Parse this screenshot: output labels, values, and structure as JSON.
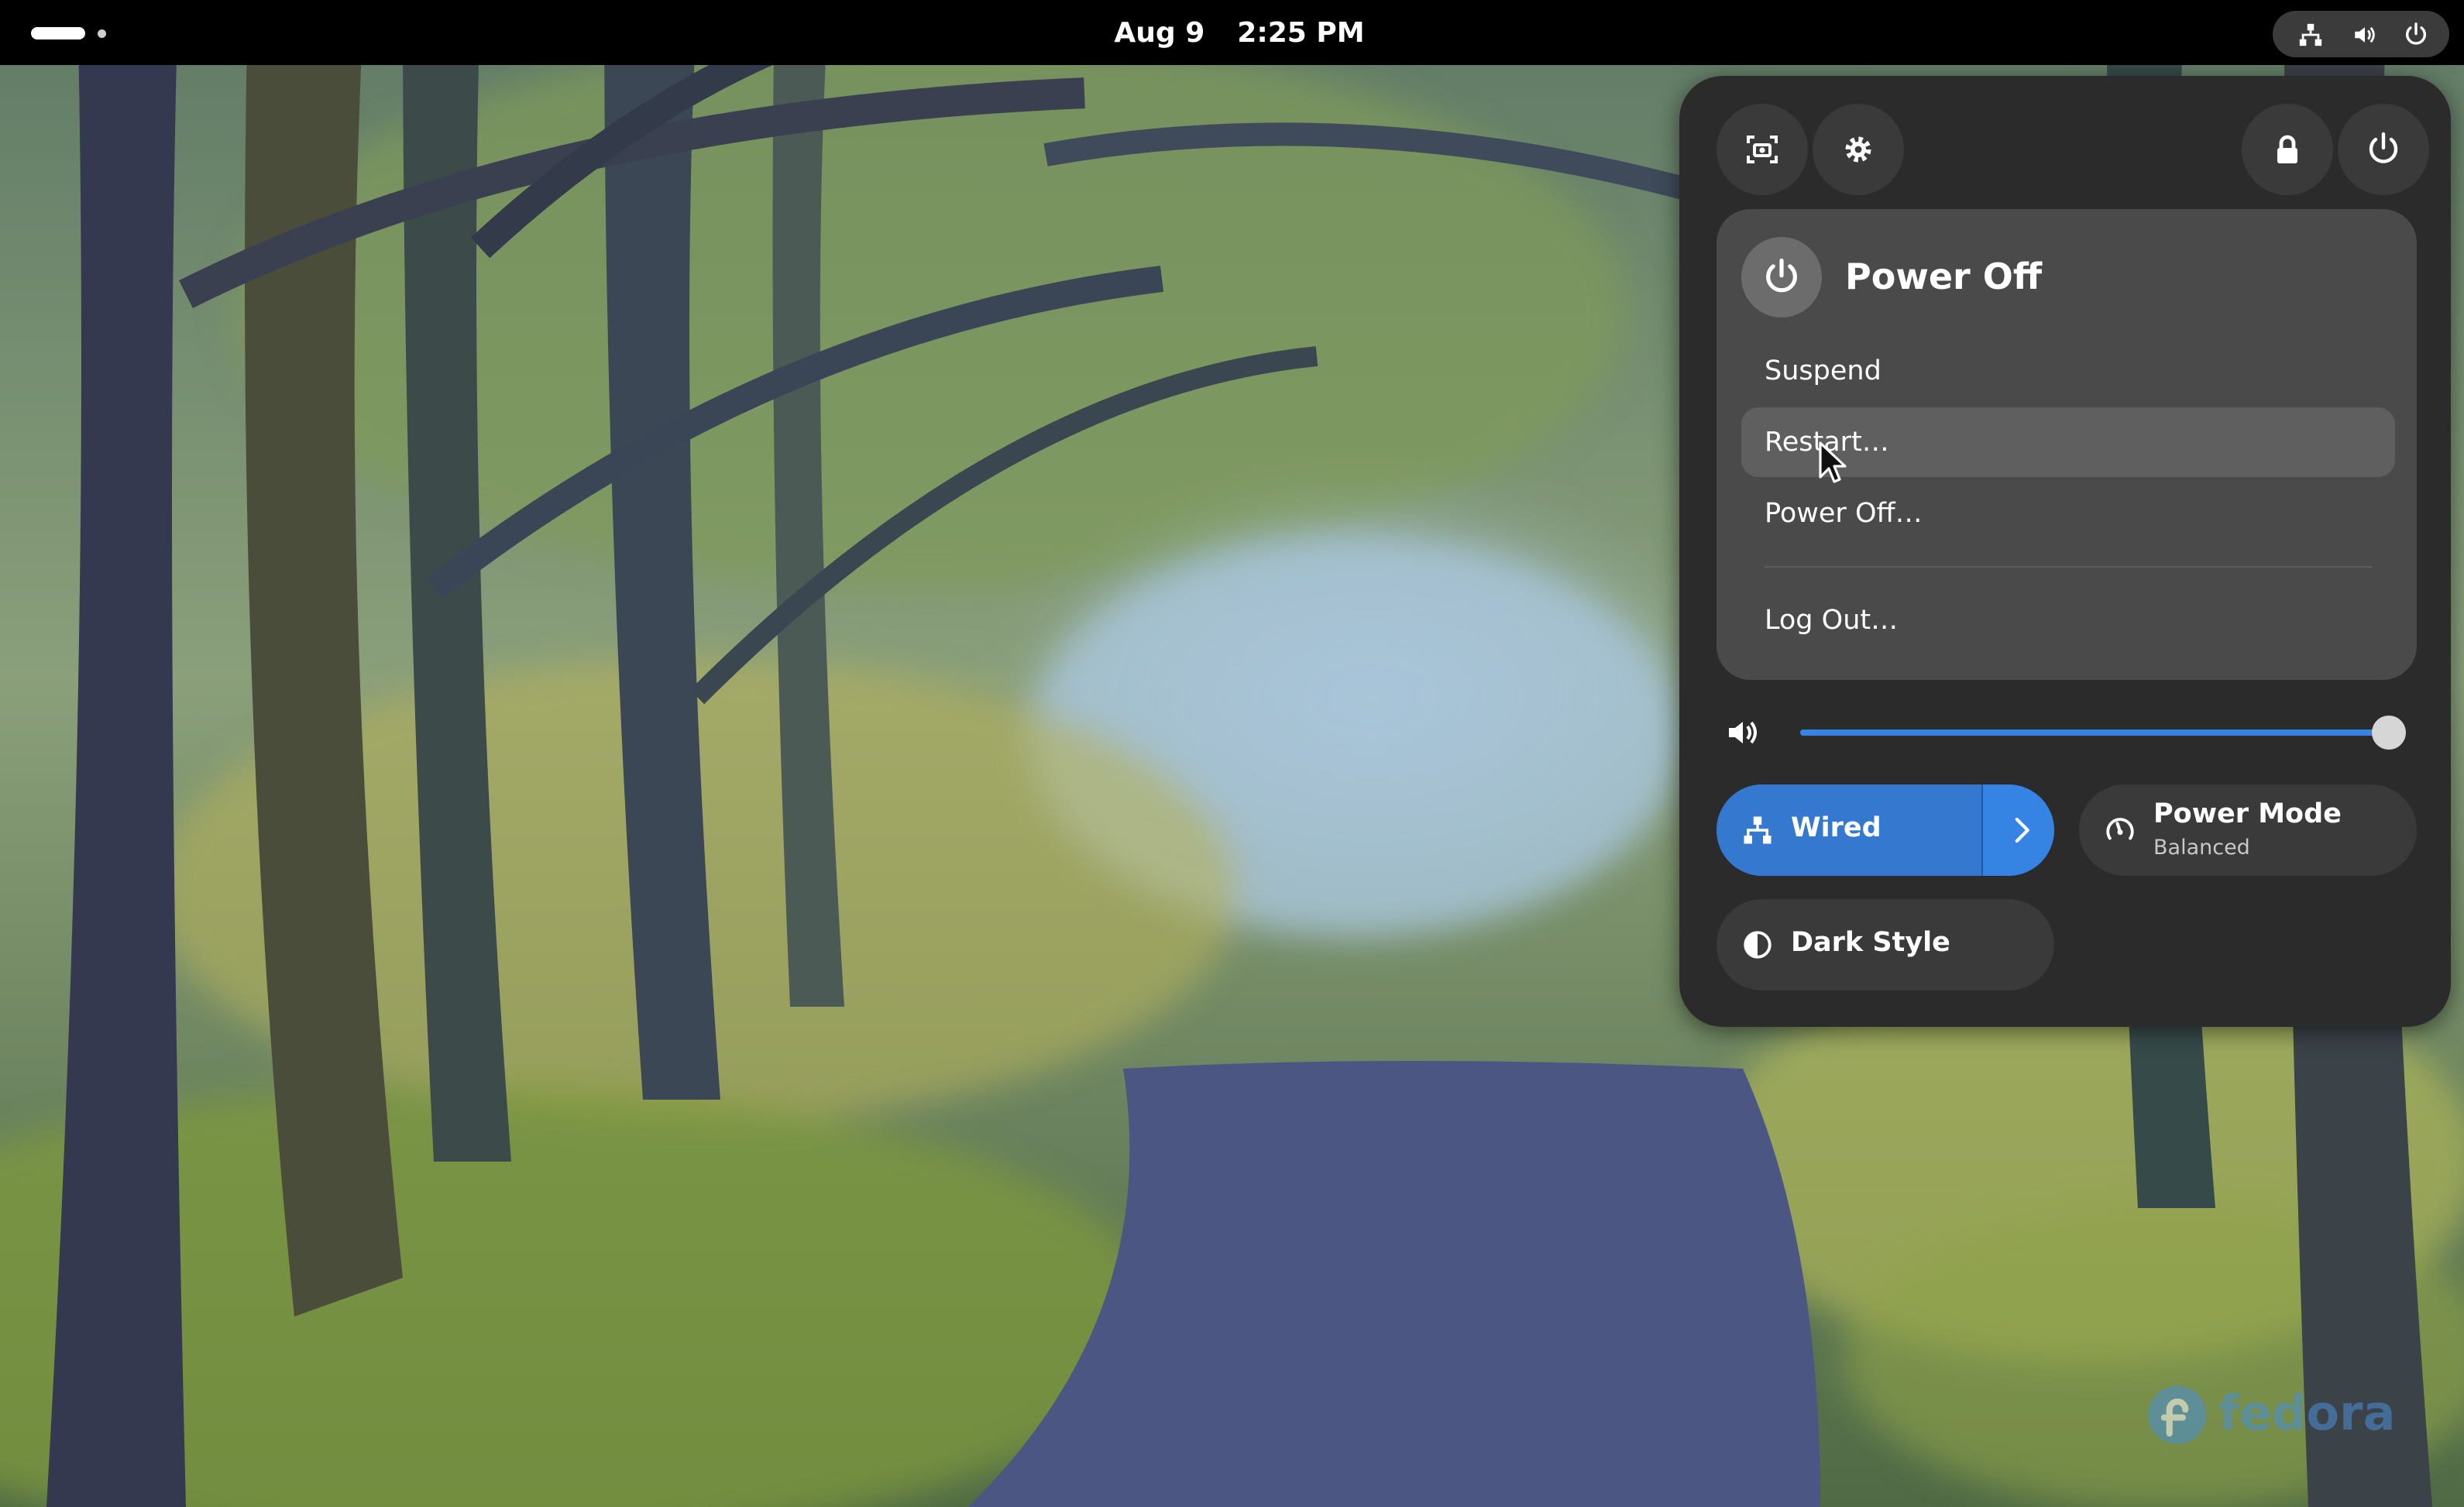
{
  "topbar": {
    "date": "Aug 9",
    "time": "2:25 PM",
    "indicators": [
      "network-wired-icon",
      "volume-icon",
      "power-icon"
    ]
  },
  "quick_settings": {
    "top_buttons": [
      "screenshot-icon",
      "settings-icon",
      "lock-icon",
      "power-icon"
    ],
    "power_submenu": {
      "title": "Power Off",
      "items": [
        "Suspend",
        "Restart…",
        "Power Off…",
        "Log Out…"
      ],
      "hovered": "Restart…"
    },
    "volume": {
      "icon": "volume-icon",
      "level": 1.0
    },
    "toggles": {
      "wired": {
        "label": "Wired",
        "active": true
      },
      "power_mode": {
        "label": "Power Mode",
        "subtitle": "Balanced"
      },
      "dark_style": {
        "label": "Dark Style"
      }
    }
  },
  "watermark": {
    "text": "fedora"
  },
  "colors": {
    "accent": "#3584e4",
    "panel": "#2b2b2b",
    "submenu": "#4a4a4a"
  }
}
